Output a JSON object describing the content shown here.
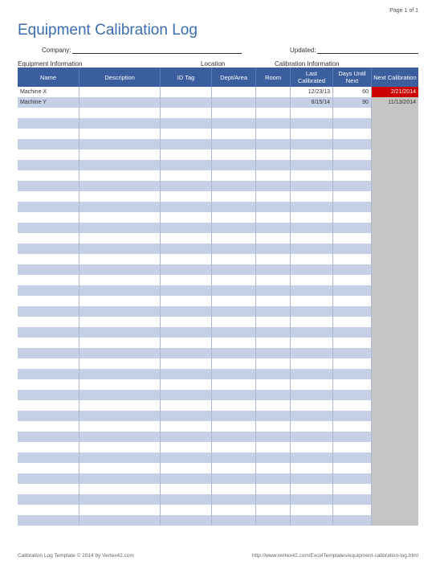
{
  "page_number": "Page 1 of 1",
  "title": "Equipment Calibration Log",
  "meta": {
    "company_label": "Company:",
    "updated_label": "Updated:"
  },
  "sections": {
    "equipment": "Equipment Information",
    "location": "Location",
    "calibration": "Calibration Information"
  },
  "headers": {
    "name": "Name",
    "description": "Description",
    "idtag": "ID Tag",
    "dept": "Dept/Area",
    "room": "Room",
    "last": "Last Calibrated",
    "days": "Days Until Next",
    "next": "Next Calibration"
  },
  "rows": [
    {
      "name": "Machine X",
      "last": "12/23/13",
      "days": "60",
      "next": "2/21/2014",
      "overdue": true
    },
    {
      "name": "Machine Y",
      "last": "8/15/14",
      "days": "90",
      "next": "11/13/2014",
      "overdue": false
    }
  ],
  "empty_row_count": 40,
  "footer": {
    "left": "Calibration Log Template © 2014 by Vertex42.com",
    "right": "http://www.vertex42.com/ExcelTemplates/equipment-calibration-log.html"
  },
  "chart_data": {
    "type": "table",
    "title": "Equipment Calibration Log",
    "columns": [
      "Name",
      "Description",
      "ID Tag",
      "Dept/Area",
      "Room",
      "Last Calibrated",
      "Days Until Next",
      "Next Calibration"
    ],
    "rows": [
      [
        "Machine X",
        "",
        "",
        "",
        "",
        "12/23/13",
        60,
        "2/21/2014"
      ],
      [
        "Machine Y",
        "",
        "",
        "",
        "",
        "8/15/14",
        90,
        "11/13/2014"
      ]
    ]
  }
}
